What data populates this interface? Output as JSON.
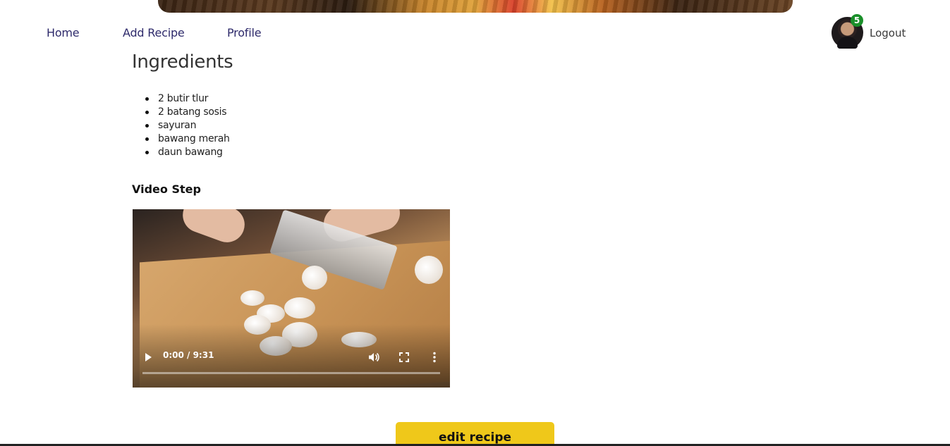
{
  "nav": {
    "home": "Home",
    "add_recipe": "Add Recipe",
    "profile": "Profile",
    "logout": "Logout",
    "notification_count": "5"
  },
  "recipe": {
    "ingredients_title": "Ingredients",
    "ingredients": [
      "2 butir tlur",
      "2 batang sosis",
      "sayuran",
      "bawang merah",
      "daun bawang"
    ],
    "video_title": "Video Step",
    "video": {
      "time_display": "0:00 / 9:31",
      "progress": 0
    },
    "edit_label": "edit recipe"
  },
  "colors": {
    "accent": "#efc81a",
    "nav_link": "#2e2a6b",
    "badge": "#1a8f2a"
  },
  "icons": {
    "play": "play-icon",
    "volume": "volume-icon",
    "fullscreen": "fullscreen-icon",
    "more": "more-vertical-icon"
  }
}
